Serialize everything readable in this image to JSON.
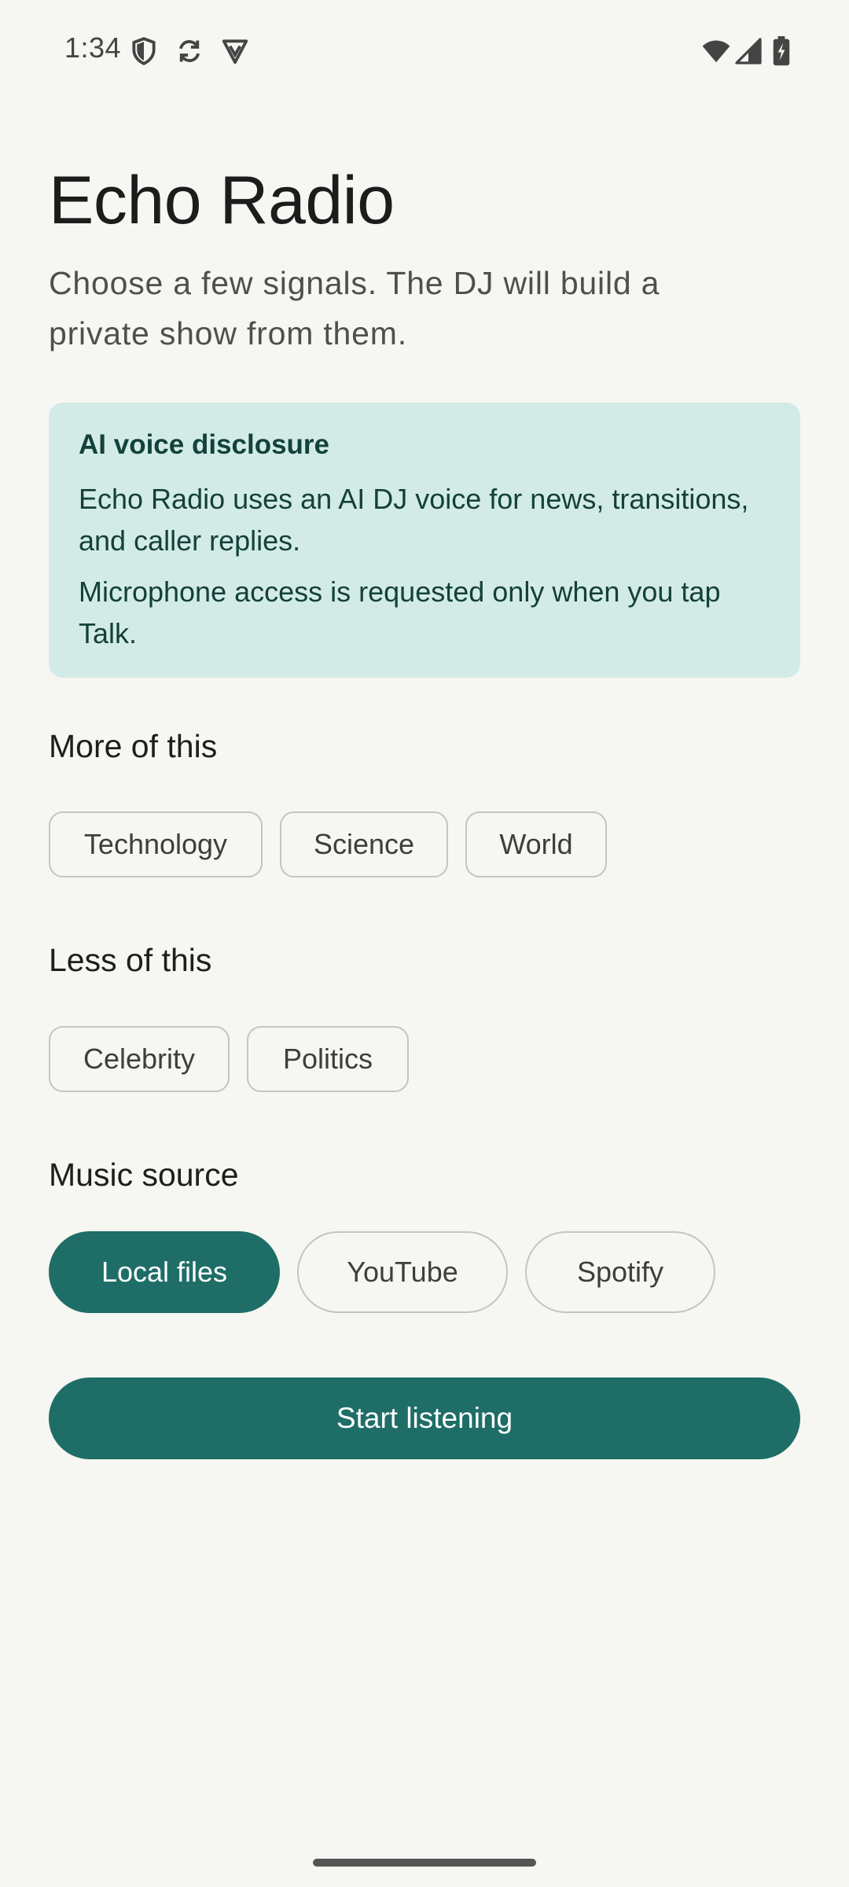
{
  "status_bar": {
    "time": "1:34",
    "left_icons": [
      "shield-icon",
      "sync-icon",
      "vpn-icon"
    ],
    "right_icons": [
      "wifi-icon",
      "cell-signal-icon",
      "battery-charging-icon"
    ]
  },
  "header": {
    "title": "Echo Radio",
    "subtitle": "Choose a few signals. The DJ will build a private show from them."
  },
  "disclosure": {
    "title": "AI voice disclosure",
    "line1": "Echo Radio uses an AI DJ voice for news, transitions, and caller replies.",
    "line2": "Microphone access is requested only when you tap Talk."
  },
  "more_of_this": {
    "heading": "More of this",
    "chips": [
      "Technology",
      "Science",
      "World"
    ]
  },
  "less_of_this": {
    "heading": "Less of this",
    "chips": [
      "Celebrity",
      "Politics"
    ]
  },
  "music_source": {
    "heading": "Music source",
    "options": [
      "Local files",
      "YouTube",
      "Spotify"
    ],
    "selected": "Local files"
  },
  "actions": {
    "start_label": "Start listening"
  },
  "colors": {
    "accent": "#1e6e67",
    "card_bg": "#d3ebe6",
    "background": "#f6f6f2"
  }
}
